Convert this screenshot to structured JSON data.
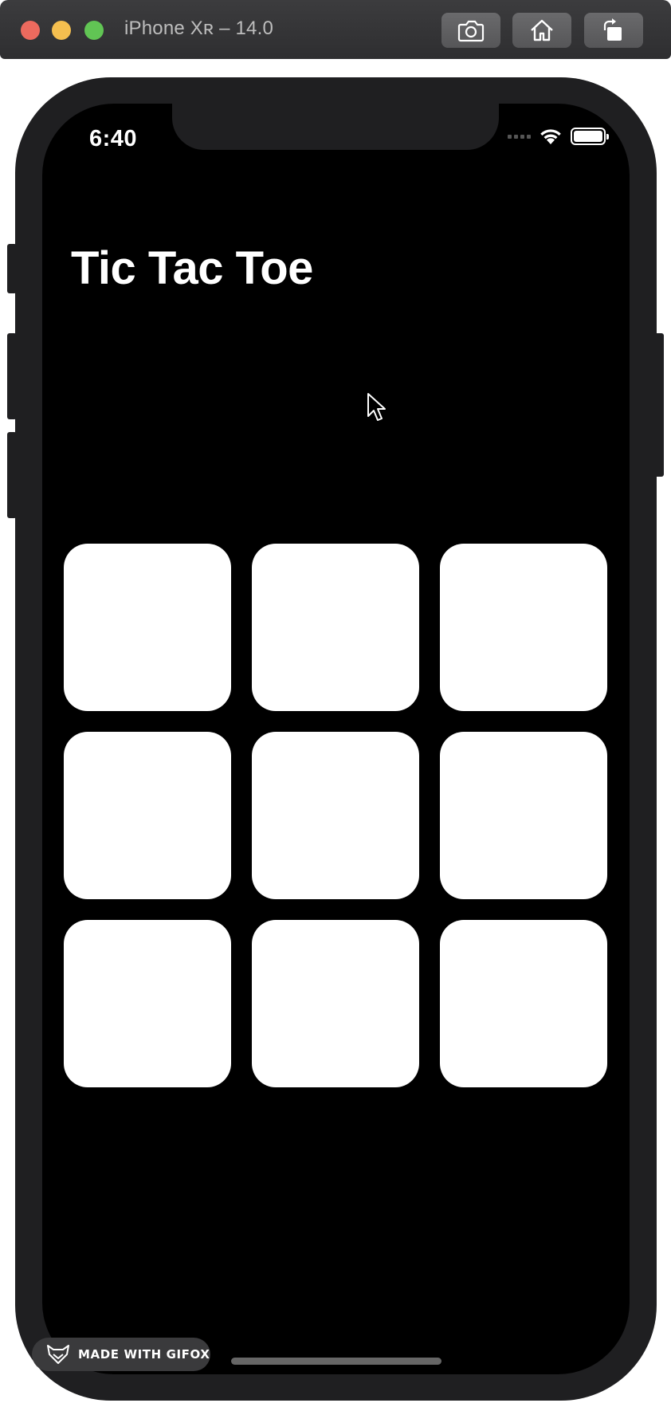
{
  "window": {
    "title": "iPhone Xʀ – 14.0",
    "buttons": [
      "screenshot-icon",
      "home-icon",
      "rotate-icon"
    ]
  },
  "status_bar": {
    "time": "6:40",
    "icons": [
      "cellular-signal-icon",
      "wifi-icon",
      "battery-icon"
    ]
  },
  "app": {
    "title": "Tic Tac Toe",
    "board": {
      "rows": 3,
      "cols": 3,
      "cells": [
        "",
        "",
        "",
        "",
        "",
        "",
        "",
        "",
        ""
      ]
    }
  },
  "watermark": {
    "label": "MADE WITH GIFOX",
    "icon": "fox-icon"
  },
  "colors": {
    "screen_background": "#000000",
    "cell_background": "#ffffff",
    "title_text": "#ffffff"
  }
}
